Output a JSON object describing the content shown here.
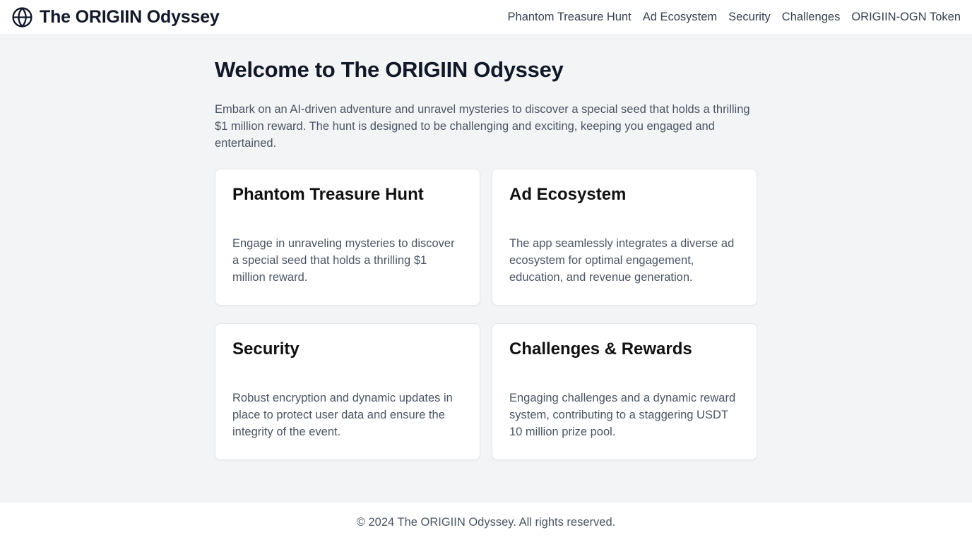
{
  "header": {
    "title": "The ORIGIIN Odyssey",
    "logo_icon": "globe-icon",
    "nav": [
      {
        "label": "Phantom Treasure Hunt"
      },
      {
        "label": "Ad Ecosystem"
      },
      {
        "label": "Security"
      },
      {
        "label": "Challenges"
      },
      {
        "label": "ORIGIIN-OGN Token"
      }
    ]
  },
  "main": {
    "heading": "Welcome to The ORIGIIN Odyssey",
    "intro": "Embark on an AI-driven adventure and unravel mysteries to discover a special seed that holds a thrilling $1 million reward. The hunt is designed to be challenging and exciting, keeping you engaged and entertained.",
    "cards": [
      {
        "title": "Phantom Treasure Hunt",
        "text": "Engage in unraveling mysteries to discover a special seed that holds a thrilling $1 million reward."
      },
      {
        "title": "Ad Ecosystem",
        "text": "The app seamlessly integrates a diverse ad ecosystem for optimal engagement, education, and revenue generation."
      },
      {
        "title": "Security",
        "text": "Robust encryption and dynamic updates in place to protect user data and ensure the integrity of the event."
      },
      {
        "title": "Challenges & Rewards",
        "text": "Engaging challenges and a dynamic reward system, contributing to a staggering USDT 10 million prize pool."
      }
    ]
  },
  "footer": {
    "text": "© 2024 The ORIGIIN Odyssey. All rights reserved."
  },
  "colors": {
    "background": "#f3f4f6",
    "surface": "#ffffff",
    "heading": "#111827",
    "body_text": "#4b5563",
    "border": "#e5e7eb"
  }
}
